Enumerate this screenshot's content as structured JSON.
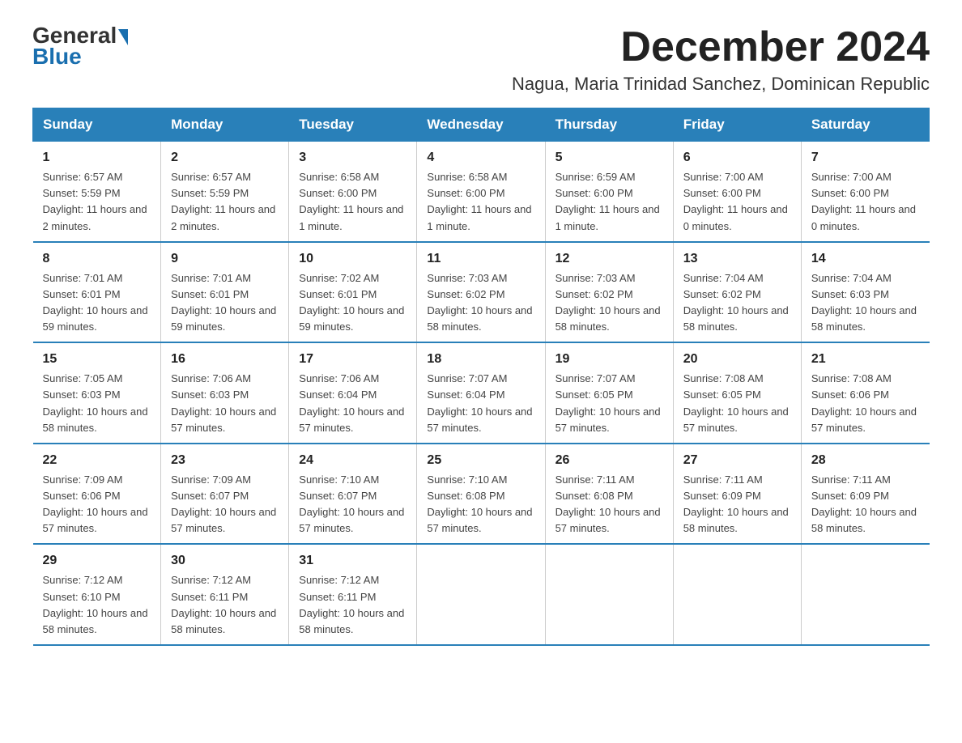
{
  "header": {
    "logo": {
      "part1": "General",
      "arrow": "▶",
      "part2": "Blue"
    },
    "title": "December 2024",
    "location": "Nagua, Maria Trinidad Sanchez, Dominican Republic"
  },
  "columns": [
    "Sunday",
    "Monday",
    "Tuesday",
    "Wednesday",
    "Thursday",
    "Friday",
    "Saturday"
  ],
  "weeks": [
    [
      {
        "day": "1",
        "sunrise": "6:57 AM",
        "sunset": "5:59 PM",
        "daylight": "11 hours and 2 minutes."
      },
      {
        "day": "2",
        "sunrise": "6:57 AM",
        "sunset": "5:59 PM",
        "daylight": "11 hours and 2 minutes."
      },
      {
        "day": "3",
        "sunrise": "6:58 AM",
        "sunset": "6:00 PM",
        "daylight": "11 hours and 1 minute."
      },
      {
        "day": "4",
        "sunrise": "6:58 AM",
        "sunset": "6:00 PM",
        "daylight": "11 hours and 1 minute."
      },
      {
        "day": "5",
        "sunrise": "6:59 AM",
        "sunset": "6:00 PM",
        "daylight": "11 hours and 1 minute."
      },
      {
        "day": "6",
        "sunrise": "7:00 AM",
        "sunset": "6:00 PM",
        "daylight": "11 hours and 0 minutes."
      },
      {
        "day": "7",
        "sunrise": "7:00 AM",
        "sunset": "6:00 PM",
        "daylight": "11 hours and 0 minutes."
      }
    ],
    [
      {
        "day": "8",
        "sunrise": "7:01 AM",
        "sunset": "6:01 PM",
        "daylight": "10 hours and 59 minutes."
      },
      {
        "day": "9",
        "sunrise": "7:01 AM",
        "sunset": "6:01 PM",
        "daylight": "10 hours and 59 minutes."
      },
      {
        "day": "10",
        "sunrise": "7:02 AM",
        "sunset": "6:01 PM",
        "daylight": "10 hours and 59 minutes."
      },
      {
        "day": "11",
        "sunrise": "7:03 AM",
        "sunset": "6:02 PM",
        "daylight": "10 hours and 58 minutes."
      },
      {
        "day": "12",
        "sunrise": "7:03 AM",
        "sunset": "6:02 PM",
        "daylight": "10 hours and 58 minutes."
      },
      {
        "day": "13",
        "sunrise": "7:04 AM",
        "sunset": "6:02 PM",
        "daylight": "10 hours and 58 minutes."
      },
      {
        "day": "14",
        "sunrise": "7:04 AM",
        "sunset": "6:03 PM",
        "daylight": "10 hours and 58 minutes."
      }
    ],
    [
      {
        "day": "15",
        "sunrise": "7:05 AM",
        "sunset": "6:03 PM",
        "daylight": "10 hours and 58 minutes."
      },
      {
        "day": "16",
        "sunrise": "7:06 AM",
        "sunset": "6:03 PM",
        "daylight": "10 hours and 57 minutes."
      },
      {
        "day": "17",
        "sunrise": "7:06 AM",
        "sunset": "6:04 PM",
        "daylight": "10 hours and 57 minutes."
      },
      {
        "day": "18",
        "sunrise": "7:07 AM",
        "sunset": "6:04 PM",
        "daylight": "10 hours and 57 minutes."
      },
      {
        "day": "19",
        "sunrise": "7:07 AM",
        "sunset": "6:05 PM",
        "daylight": "10 hours and 57 minutes."
      },
      {
        "day": "20",
        "sunrise": "7:08 AM",
        "sunset": "6:05 PM",
        "daylight": "10 hours and 57 minutes."
      },
      {
        "day": "21",
        "sunrise": "7:08 AM",
        "sunset": "6:06 PM",
        "daylight": "10 hours and 57 minutes."
      }
    ],
    [
      {
        "day": "22",
        "sunrise": "7:09 AM",
        "sunset": "6:06 PM",
        "daylight": "10 hours and 57 minutes."
      },
      {
        "day": "23",
        "sunrise": "7:09 AM",
        "sunset": "6:07 PM",
        "daylight": "10 hours and 57 minutes."
      },
      {
        "day": "24",
        "sunrise": "7:10 AM",
        "sunset": "6:07 PM",
        "daylight": "10 hours and 57 minutes."
      },
      {
        "day": "25",
        "sunrise": "7:10 AM",
        "sunset": "6:08 PM",
        "daylight": "10 hours and 57 minutes."
      },
      {
        "day": "26",
        "sunrise": "7:11 AM",
        "sunset": "6:08 PM",
        "daylight": "10 hours and 57 minutes."
      },
      {
        "day": "27",
        "sunrise": "7:11 AM",
        "sunset": "6:09 PM",
        "daylight": "10 hours and 58 minutes."
      },
      {
        "day": "28",
        "sunrise": "7:11 AM",
        "sunset": "6:09 PM",
        "daylight": "10 hours and 58 minutes."
      }
    ],
    [
      {
        "day": "29",
        "sunrise": "7:12 AM",
        "sunset": "6:10 PM",
        "daylight": "10 hours and 58 minutes."
      },
      {
        "day": "30",
        "sunrise": "7:12 AM",
        "sunset": "6:11 PM",
        "daylight": "10 hours and 58 minutes."
      },
      {
        "day": "31",
        "sunrise": "7:12 AM",
        "sunset": "6:11 PM",
        "daylight": "10 hours and 58 minutes."
      },
      null,
      null,
      null,
      null
    ]
  ]
}
